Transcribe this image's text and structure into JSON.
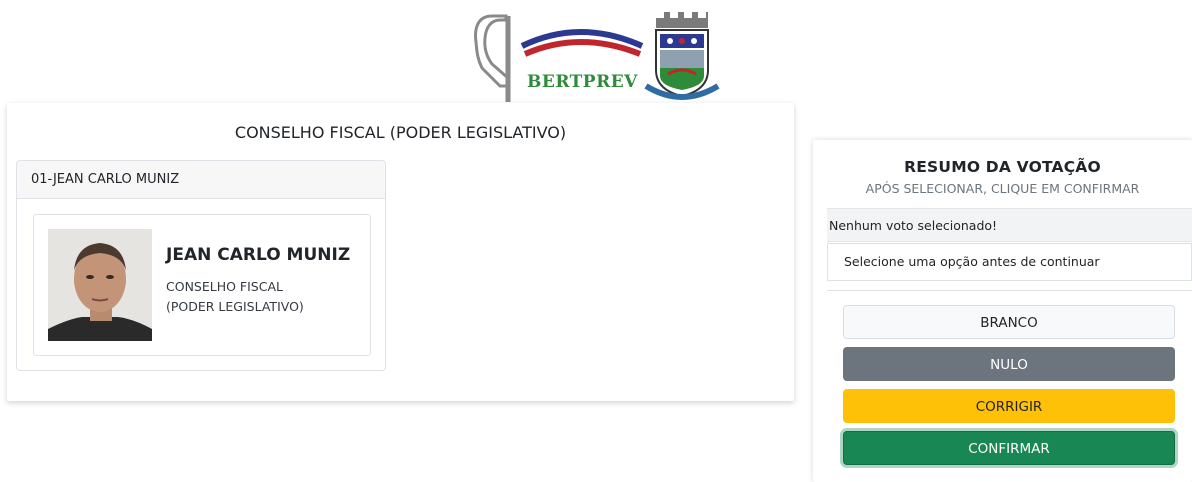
{
  "header": {
    "logo_text": "BERTPREV"
  },
  "ballot": {
    "title": "CONSELHO FISCAL (PODER LEGISLATIVO)",
    "candidate": {
      "header_label": "01-JEAN CARLO MUNIZ",
      "name": "JEAN CARLO MUNIZ",
      "role_line1": "CONSELHO FISCAL",
      "role_line2": "(PODER LEGISLATIVO)"
    }
  },
  "summary": {
    "title": "RESUMO DA VOTAÇÃO",
    "subtitle": "APÓS SELECIONAR, CLIQUE EM CONFIRMAR",
    "no_vote": "Nenhum voto selecionado!",
    "hint": "Selecione uma opção antes de continuar",
    "buttons": {
      "branco": "BRANCO",
      "nulo": "NULO",
      "corrigir": "CORRIGIR",
      "confirmar": "CONFIRMAR"
    }
  },
  "colors": {
    "logo_green": "#2e8b3a",
    "logo_red": "#c0272d",
    "logo_blue": "#2b3990",
    "nulo": "#6c757d",
    "corrigir": "#ffc107",
    "confirmar": "#198754"
  }
}
